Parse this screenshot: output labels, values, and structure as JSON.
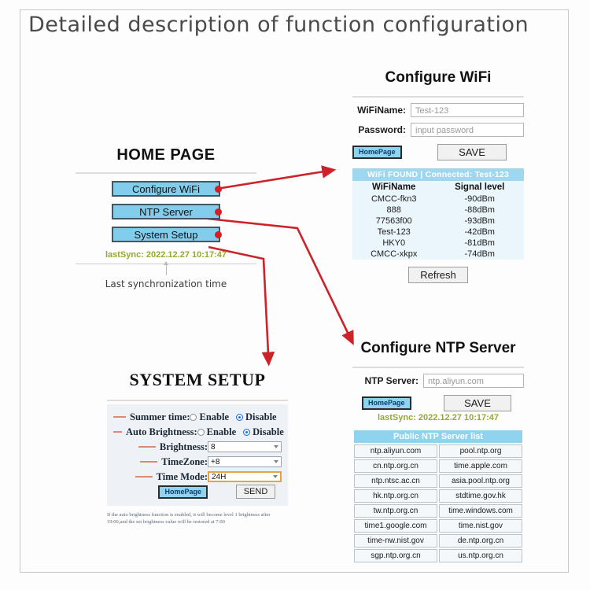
{
  "page": {
    "title": "Detailed description of function configuration"
  },
  "home": {
    "title": "HOME PAGE",
    "buttons": [
      {
        "label": "Configure WiFi"
      },
      {
        "label": "NTP Server"
      },
      {
        "label": "System Setup"
      }
    ],
    "last_sync": "lastSync: 2022.12.27 10:17:47",
    "caption": "Last synchronization time"
  },
  "wifi": {
    "title": "Configure WiFi",
    "fields": [
      {
        "label": "WiFiName:",
        "value": "Test-123"
      },
      {
        "label": "Password:",
        "value": "input password"
      }
    ],
    "home_button": "HomePage",
    "save_button": "SAVE",
    "table_header": "WiFi FOUND  |  Connected: Test-123",
    "columns": [
      "WiFiName",
      "Signal level"
    ],
    "rows": [
      [
        "CMCC-fkn3",
        "-90dBm"
      ],
      [
        "888",
        "-88dBm"
      ],
      [
        "77563f00",
        "-93dBm"
      ],
      [
        "Test-123",
        "-42dBm"
      ],
      [
        "HKY0",
        "-81dBm"
      ],
      [
        "CMCC-xkpx",
        "-74dBm"
      ]
    ],
    "refresh_button": "Refresh"
  },
  "ntp": {
    "title": "Configure NTP Server",
    "field_label": "NTP Server:",
    "field_value": "ntp.aliyun.com",
    "home_button": "HomePage",
    "save_button": "SAVE",
    "last_sync": "lastSync: 2022.12.27 10:17:47",
    "list_header": "Public NTP Server list",
    "servers": [
      [
        "ntp.aliyun.com",
        "pool.ntp.org"
      ],
      [
        "cn.ntp.org.cn",
        "time.apple.com"
      ],
      [
        "ntp.ntsc.ac.cn",
        "asia.pool.ntp.org"
      ],
      [
        "hk.ntp.org.cn",
        "stdtime.gov.hk"
      ],
      [
        "tw.ntp.org.cn",
        "time.windows.com"
      ],
      [
        "time1.google.com",
        "time.nist.gov"
      ],
      [
        "time-nw.nist.gov",
        "de.ntp.org.cn"
      ],
      [
        "sgp.ntp.org.cn",
        "us.ntp.org.cn"
      ]
    ]
  },
  "system": {
    "title": "SYSTEM SETUP",
    "radio_rows": [
      {
        "label": "Summer time:",
        "enable": "Enable",
        "disable": "Disable",
        "selected": "Disable"
      },
      {
        "label": "Auto Brightness:",
        "enable": "Enable",
        "disable": "Disable",
        "selected": "Disable"
      }
    ],
    "select_rows": [
      {
        "label": "Brightness:",
        "value": "8",
        "focused": false
      },
      {
        "label": "TimeZone:",
        "value": "+8",
        "focused": false
      },
      {
        "label": "Time Mode:",
        "value": "24H",
        "focused": true
      }
    ],
    "home_button": "HomePage",
    "send_button": "SEND",
    "note": "If the auto brightness function is enabled, it will become level 1 brightness after 19:00,and the set brightness value will be restored at 7:00"
  },
  "colors": {
    "accent_blue": "#82cdeb",
    "header_blue": "#9ed8f0",
    "arrow_red": "#cc2229",
    "sync_green": "#97a832",
    "focus_orange": "#e2a53f"
  }
}
